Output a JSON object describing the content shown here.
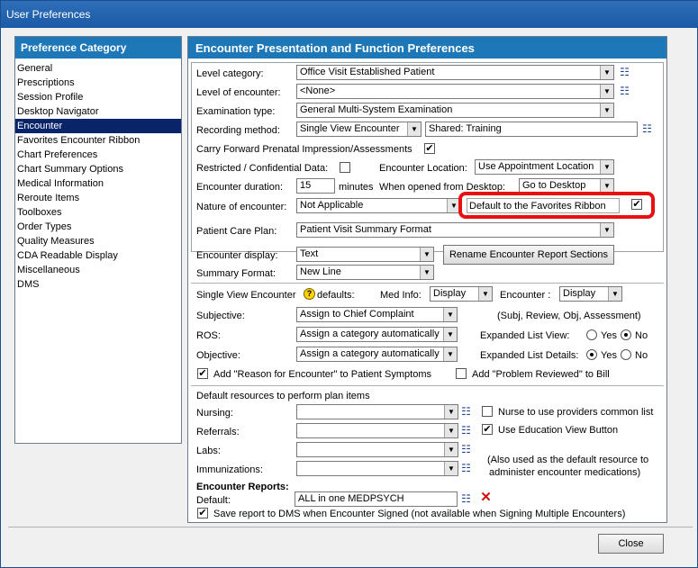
{
  "window": {
    "title": "User Preferences"
  },
  "left_panel": {
    "header": "Preference Category",
    "items": [
      "General",
      "Prescriptions",
      "Session Profile",
      "Desktop Navigator",
      "Encounter",
      "Favorites Encounter Ribbon",
      "Chart Preferences",
      "Chart Summary Options",
      "Medical Information",
      "Reroute Items",
      "Toolboxes",
      "Order Types",
      "Quality Measures",
      "CDA Readable Display",
      "Miscellaneous",
      "DMS"
    ],
    "selected": "Encounter"
  },
  "right_panel": {
    "header": "Encounter Presentation and Function Preferences",
    "level_category": {
      "label": "Level category:",
      "value": "Office Visit Established Patient"
    },
    "level_encounter": {
      "label": "Level of encounter:",
      "value": "<None>"
    },
    "examination_type": {
      "label": "Examination type:",
      "value": "General Multi-System Examination"
    },
    "recording_method": {
      "label": "Recording method:",
      "value": "Single View Encounter",
      "shared": "Shared: Training"
    },
    "carry_forward": {
      "label": "Carry Forward Prenatal Impression/Assessments",
      "checked": true
    },
    "restricted": {
      "label": "Restricted / Confidential Data:",
      "checked": false
    },
    "encounter_location": {
      "label": "Encounter Location:",
      "value": "Use Appointment Location"
    },
    "encounter_duration": {
      "label": "Encounter duration:",
      "value": "15",
      "unit": "minutes"
    },
    "when_opened": {
      "label": "When opened from Desktop:",
      "value": "Go to Desktop"
    },
    "nature": {
      "label": "Nature of encounter:",
      "value": "Not Applicable"
    },
    "default_favorites": {
      "label": "Default to the Favorites Ribbon",
      "checked": true
    },
    "patient_care_plan": {
      "label": "Patient Care Plan:",
      "value": "Patient Visit Summary Format"
    },
    "encounter_display": {
      "label": "Encounter display:",
      "value": "Text"
    },
    "summary_format": {
      "label": "Summary Format:",
      "value": "New Line"
    },
    "rename_button": "Rename Encounter Report Sections",
    "sve_defaults": {
      "label_a": "Single View Encounter",
      "label_b": "defaults:",
      "med_info_label": "Med Info:",
      "med_info_value": "Display",
      "encounter_label": "Encounter :",
      "encounter_value": "Display"
    },
    "subjective": {
      "label": "Subjective:",
      "value": "Assign to Chief Complaint"
    },
    "ros": {
      "label": "ROS:",
      "value": "Assign a category automatically"
    },
    "objective": {
      "label": "Objective:",
      "value": "Assign a category automatically"
    },
    "subj_note": "(Subj, Review, Obj, Assessment)",
    "expanded_list_view": {
      "label": "Expanded List View:",
      "yes": "Yes",
      "no": "No",
      "selected": "No"
    },
    "expanded_list_details": {
      "label": "Expanded List Details:",
      "yes": "Yes",
      "no": "No",
      "selected": "Yes"
    },
    "add_reason": {
      "label": "Add \"Reason for Encounter\" to Patient Symptoms",
      "checked": true
    },
    "add_problem": {
      "label": "Add \"Problem Reviewed\" to Bill",
      "checked": false
    },
    "default_resources": {
      "label": "Default resources to perform plan items"
    },
    "nursing": {
      "label": "Nursing:",
      "value": ""
    },
    "referrals": {
      "label": "Referrals:",
      "value": ""
    },
    "labs": {
      "label": "Labs:",
      "value": ""
    },
    "immunizations": {
      "label": "Immunizations:",
      "value": ""
    },
    "nurse_common": {
      "label": "Nurse to use providers common list",
      "checked": false
    },
    "education_view": {
      "label": "Use Education View Button",
      "checked": true
    },
    "also_used_note_1": "(Also used as the default resource to",
    "also_used_note_2": "administer encounter medications)",
    "encounter_reports": {
      "label": "Encounter Reports:",
      "default_label": "Default:",
      "default_value": "ALL in one MEDPSYCH"
    },
    "save_report": {
      "label": "Save report to DMS when Encounter Signed (not available when Signing Multiple Encounters)",
      "checked": true
    }
  },
  "close_button": "Close"
}
